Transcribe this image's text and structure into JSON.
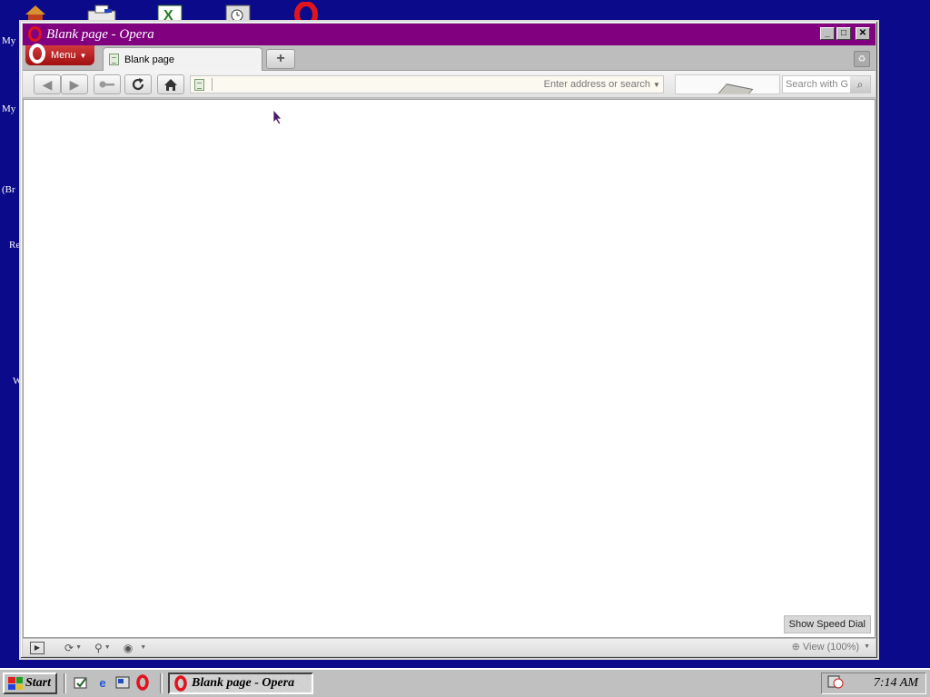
{
  "desktop": {
    "labels": [
      "My",
      "My",
      "(Br",
      "Re",
      "W"
    ]
  },
  "window": {
    "title": "Blank page - Opera",
    "minimize": "_",
    "maximize": "□",
    "close": "✕"
  },
  "menu": {
    "label": "Menu"
  },
  "tabs": [
    {
      "label": "Blank page"
    }
  ],
  "address": {
    "value": "",
    "placeholder": "Enter address or search"
  },
  "search": {
    "placeholder": "Search with G"
  },
  "content": {
    "speed_dial_label": "Show Speed Dial"
  },
  "statusbar": {
    "zoom_label": "View (100%)"
  },
  "taskbar": {
    "start_label": "Start",
    "active_task": "Blank page - Opera",
    "clock": "7:14 AM"
  },
  "colors": {
    "desktop": "#0a0a8a",
    "titlebar": "#800080",
    "opera_red": "#e0141e"
  }
}
